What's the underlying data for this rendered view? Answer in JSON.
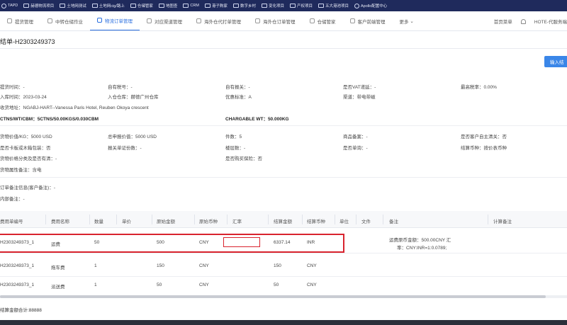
{
  "bookmarks": [
    {
      "label": "TAPD",
      "icon": "globe-icon"
    },
    {
      "label": "赫德物流项目",
      "icon": "folder-icon"
    },
    {
      "label": "土地网测试",
      "icon": "folder-icon"
    },
    {
      "label": "土地网cig/路上",
      "icon": "folder-icon"
    },
    {
      "label": "仓储管家",
      "icon": "folder-icon"
    },
    {
      "label": "地图查",
      "icon": "folder-icon"
    },
    {
      "label": "CRM",
      "icon": "folder-icon"
    },
    {
      "label": "港子购家",
      "icon": "folder-icon"
    },
    {
      "label": "数字乡村",
      "icon": "folder-icon"
    },
    {
      "label": "变化项目",
      "icon": "folder-icon"
    },
    {
      "label": "产权项目",
      "icon": "folder-icon"
    },
    {
      "label": "五大港池项目",
      "icon": "folder-icon"
    },
    {
      "label": "Apollo配置中心",
      "icon": "globe-icon"
    }
  ],
  "nav": {
    "tabs": [
      {
        "label": "提货管理"
      },
      {
        "label": "中转仓储作业"
      },
      {
        "label": "物流订单管理"
      },
      {
        "label": "对应渠道管理"
      },
      {
        "label": "海外仓代打单管理"
      },
      {
        "label": "海外仓订单管理"
      },
      {
        "label": "仓储管家"
      },
      {
        "label": "客户前端管理"
      },
      {
        "label": "更多"
      }
    ],
    "active_index": 2,
    "right": {
      "home": "首页菜单",
      "user": "HOTE-代服务端"
    }
  },
  "page": {
    "title": "结单-H2303249373",
    "import_button": "输入结"
  },
  "info": {
    "row1": [
      "提货时间：-",
      "自有税号：-",
      "自有报关：-",
      "是否VAT递延：-",
      "最高税率：0.00%"
    ],
    "row2": [
      "入库时间：2023-03-24",
      "入仓仓库：赫德广州仓库",
      "优惠标准：A",
      "渠道：带电带磁"
    ],
    "row3": "收货地址：NGABJ-HART--Vanessa Paris Hotel, Reuben Okoya crescent",
    "row4": [
      "CTNS/WT/CBM：5CTNS/50.00KGS/0.030CBM",
      "CHARGABLE WT：50.000KG"
    ],
    "row5": [
      "货物价值/KG：5000 USD",
      "总申报价值：5000 USD",
      "件数：5",
      "商品备案：-",
      "是否客户自主清关：否"
    ],
    "row6": [
      "是否卡板或木箱包装：否",
      "报关单证份数：-",
      "楼层数：-",
      "是否单询：-",
      "结算币种：按价表币种"
    ],
    "row7": [
      "货物价格分类及是否有清：-",
      "是否购买保险：否"
    ],
    "row8": "货物属性备注：含电",
    "row9": "订单备注信息(客户备注)：-",
    "row10": "内部备注：-"
  },
  "table": {
    "headers": [
      "费用单编号",
      "费用名称",
      "数量",
      "单价",
      "原始金额",
      "原始币种",
      "汇率",
      "结算金额",
      "结算币种",
      "单位",
      "文件",
      "备注",
      "计算备注"
    ],
    "rows": [
      {
        "id": "H2303249373_1",
        "name": "运费",
        "qty": "50",
        "price": "",
        "amount": "500",
        "currency": "CNY",
        "rate": "",
        "settle": "6337.14",
        "settle_currency": "INR",
        "unit": "",
        "file": "",
        "note1": "运费原币金额：500.00CNY 汇",
        "note2": "率：CNY:INR=1:0.0789;",
        "calc": ""
      },
      {
        "id": "H2303249373_1",
        "name": "拖车费",
        "qty": "1",
        "price": "",
        "amount": "150",
        "currency": "CNY",
        "rate": "",
        "settle": "150",
        "settle_currency": "CNY",
        "unit": "",
        "file": "",
        "note1": "",
        "note2": "",
        "calc": ""
      },
      {
        "id": "H2303249373_1",
        "name": "派送费",
        "qty": "1",
        "price": "",
        "amount": "50",
        "currency": "CNY",
        "rate": "",
        "settle": "50",
        "settle_currency": "CNY",
        "unit": "",
        "file": "",
        "note1": "",
        "note2": "",
        "calc": ""
      }
    ]
  },
  "footer": {
    "total": "结算金额合计:88888"
  },
  "colors": {
    "accent": "#2a6fe0",
    "highlight": "#d9232e",
    "bookmark_bar": "#1f2a5c"
  }
}
